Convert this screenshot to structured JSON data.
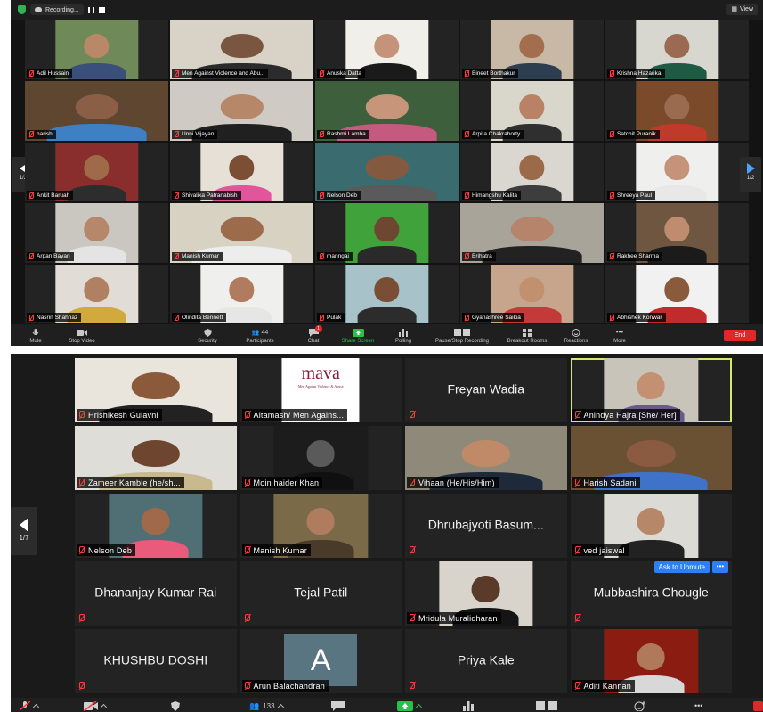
{
  "shot1": {
    "recording_label": "Recording...",
    "view_label": "View",
    "page_indicator_left": "1/2",
    "page_indicator_right": "1/2",
    "participants": [
      {
        "name": "Adil Hussain",
        "bg": "#6f8a58",
        "skin": "#b98868",
        "shirt": "#3a4f7a"
      },
      {
        "name": "Men Against Violence and Abu...",
        "bg": "#d9d3c7",
        "skin": "#7a5640",
        "shirt": "#2b2b2b"
      },
      {
        "name": "Anuska Datta",
        "bg": "#f1efe9",
        "skin": "#c4937a",
        "shirt": "#1a1a1a"
      },
      {
        "name": "Bineet Borthakur",
        "bg": "#c7b9a6",
        "skin": "#a36e4e",
        "shirt": "#2c3e50"
      },
      {
        "name": "Krishna Hazarika",
        "bg": "#d7d6cf",
        "skin": "#9b6a52",
        "shirt": "#1f5a45"
      },
      {
        "name": "harish",
        "bg": "#5e4630",
        "skin": "#8a5f45",
        "shirt": "#3f7fc3"
      },
      {
        "name": "Unni Vijayan",
        "bg": "#cfcbc4",
        "skin": "#b7876a",
        "shirt": "#202020"
      },
      {
        "name": "Rashmi Lamba",
        "bg": "#3d5f3b",
        "skin": "#c6957a",
        "shirt": "#c45a80"
      },
      {
        "name": "Arpita Chakraborty",
        "bg": "#d9d6cc",
        "skin": "#b98165",
        "shirt": "#2f2f2f"
      },
      {
        "name": "Satchit Puranik",
        "bg": "#7a4a2a",
        "skin": "#9a6b4f",
        "shirt": "#c03a2b"
      },
      {
        "name": "Ankit Baruah",
        "bg": "#8a2d2d",
        "skin": "#9e6a4a",
        "shirt": "#2d2d2d"
      },
      {
        "name": "Shivalika Patranabish",
        "bg": "#e6e0d6",
        "skin": "#7a4f35",
        "shirt": "#e0559b"
      },
      {
        "name": "Nelson Deb",
        "bg": "#3a6b6e",
        "skin": "#835a40",
        "shirt": "#5a5a5a"
      },
      {
        "name": "Himangshu Kalita",
        "bg": "#dad7d0",
        "skin": "#9a6a4a",
        "shirt": "#3d3d3d"
      },
      {
        "name": "Shreeya Paul",
        "bg": "#efefed",
        "skin": "#c49379",
        "shirt": "#e8e8e8"
      },
      {
        "name": "Arpan Bayan",
        "bg": "#cac7c0",
        "skin": "#b6876b",
        "shirt": "#e4e4e4"
      },
      {
        "name": "Manish Kumar",
        "bg": "#d8d2c2",
        "skin": "#9c6b4b",
        "shirt": "#ededed"
      },
      {
        "name": "manngai",
        "bg": "#3fa23b",
        "skin": "#6e4730",
        "shirt": "#2a2a2a"
      },
      {
        "name": "Brihatra",
        "bg": "#a9a49a",
        "skin": "#b5846a",
        "shirt": "#222222"
      },
      {
        "name": "Rakhee Sharma",
        "bg": "#6e5640",
        "skin": "#c08c70",
        "shirt": "#1b1b1b"
      },
      {
        "name": "Nasrin Shahnaz",
        "bg": "#e1ddd6",
        "skin": "#b08062",
        "shirt": "#d2a93c"
      },
      {
        "name": "Olindita Bennett",
        "bg": "#efefed",
        "skin": "#b07b5e",
        "shirt": "#e6e6e6"
      },
      {
        "name": "Pulak",
        "bg": "#a7c3c9",
        "skin": "#7a4e35",
        "shirt": "#2c2c2c"
      },
      {
        "name": "Gyanashree Saikia",
        "bg": "#c6a58c",
        "skin": "#c0906f",
        "shirt": "#c23a3a"
      },
      {
        "name": "Abhishek Konwar",
        "bg": "#f1f1f1",
        "skin": "#8a5a3c",
        "shirt": "#c02c2c"
      }
    ],
    "toolbar": {
      "mute": "Mute",
      "stop_video": "Stop Video",
      "security": "Security",
      "participants": "Participants",
      "participants_count": "44",
      "chat": "Chat",
      "chat_badge": "1",
      "share_screen": "Share Screen",
      "polling": "Polling",
      "recording": "Pause/Stop Recording",
      "breakout": "Breakout Rooms",
      "reactions": "Reactions",
      "more": "More",
      "end": "End"
    }
  },
  "shot2": {
    "page_indicator": "1/7",
    "tiles": [
      {
        "kind": "video",
        "name": "Hrishikesh Gulavni",
        "bg": "#e9e4dc",
        "skin": "#8a5a3b",
        "shirt": "#222222",
        "wide": true
      },
      {
        "kind": "logo",
        "name": "Altamash/ Men Agains...",
        "logo_text": "mava",
        "logo_sub": "Men Against Violence & Abuse",
        "bg": "#ffffff"
      },
      {
        "kind": "text",
        "name": "Freyan Wadia"
      },
      {
        "kind": "video",
        "name": "Anindya Hajra [She/ Her]",
        "bg": "#c9c4ba",
        "skin": "#c49072",
        "shirt": "#6a5a8a",
        "active": true
      },
      {
        "kind": "video",
        "name": "Zameer Kamble (he/sh...",
        "bg": "#dfddd7",
        "skin": "#6e4630",
        "shirt": "#c8b98e",
        "wide": true
      },
      {
        "kind": "video",
        "name": "Moin haider Khan",
        "bg": "#1c1c1c",
        "skin": "#5a5a5a",
        "shirt": "#101010"
      },
      {
        "kind": "video",
        "name": "Vihaan (He/His/Him)",
        "bg": "#8f897a",
        "skin": "#c08a68",
        "shirt": "#1e2a3a",
        "wide": true
      },
      {
        "kind": "video",
        "name": "Harish Sadani",
        "bg": "#6b5134",
        "skin": "#8a5b40",
        "shirt": "#3f73c9",
        "wide": true
      },
      {
        "kind": "video",
        "name": "Nelson Deb",
        "bg": "#4f6f74",
        "skin": "#a06a4a",
        "shirt": "#ea5a7a"
      },
      {
        "kind": "video",
        "name": "Manish Kumar",
        "bg": "#7a6a48",
        "skin": "#b07c60",
        "shirt": "#4a3a2a"
      },
      {
        "kind": "text",
        "name": "Dhrubajyoti Basum..."
      },
      {
        "kind": "video",
        "name": "ved jaiswal",
        "bg": "#dcdad4",
        "skin": "#b7876a",
        "shirt": "#222222"
      },
      {
        "kind": "text",
        "name": "Dhananjay Kumar Rai"
      },
      {
        "kind": "text",
        "name": "Tejal Patil"
      },
      {
        "kind": "video",
        "name": "Mridula Muralidharan",
        "bg": "#d8d4cb",
        "skin": "#5a3a28",
        "shirt": "#151515"
      },
      {
        "kind": "text",
        "name": "Mubbashira Chougle",
        "ask": "Ask to Unmute",
        "ask_more": "•••"
      },
      {
        "kind": "text",
        "name": "KHUSHBU DOSHI"
      },
      {
        "kind": "avatar",
        "name": "Arun Balachandran",
        "letter": "A"
      },
      {
        "kind": "text",
        "name": "Priya Kale"
      },
      {
        "kind": "video",
        "name": "Aditi Kannan",
        "bg": "#8a1c12",
        "skin": "#b07a5a",
        "shirt": "#d8d8d8"
      }
    ],
    "toolbar": {
      "participants_count": "133"
    }
  },
  "colors": {
    "active_speaker": "#d8e86a",
    "muted_red": "#ff3b3b",
    "share_green": "#27c24c",
    "end_red": "#e02828",
    "ask_blue": "#2d7ff9"
  }
}
